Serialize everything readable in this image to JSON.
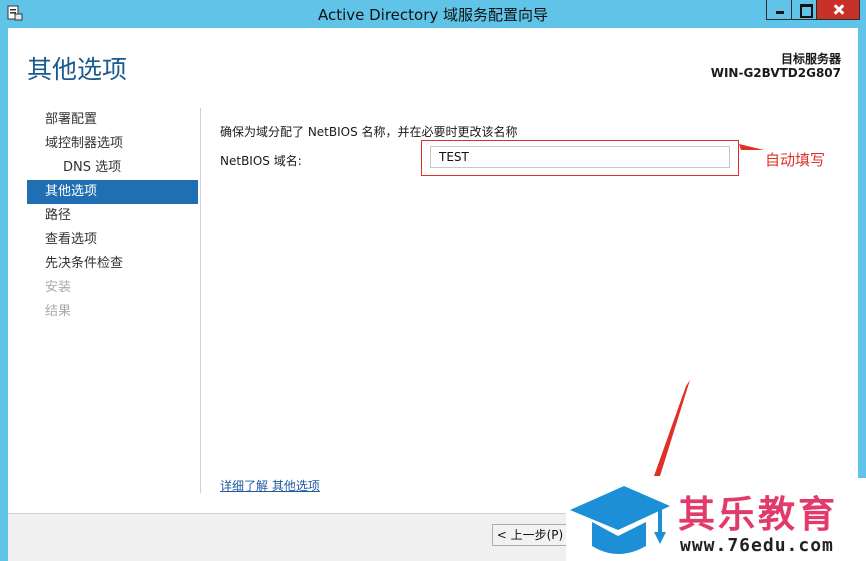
{
  "window": {
    "title": "Active Directory 域服务配置向导"
  },
  "header": {
    "page_title": "其他选项",
    "target_label": "目标服务器",
    "target_name": "WIN-G2BVTD2G807"
  },
  "nav": {
    "items": [
      {
        "label": "部署配置",
        "state": "normal"
      },
      {
        "label": "域控制器选项",
        "state": "normal"
      },
      {
        "label": "DNS 选项",
        "state": "sub"
      },
      {
        "label": "其他选项",
        "state": "active"
      },
      {
        "label": "路径",
        "state": "normal"
      },
      {
        "label": "查看选项",
        "state": "normal"
      },
      {
        "label": "先决条件检查",
        "state": "normal"
      },
      {
        "label": "安装",
        "state": "disabled"
      },
      {
        "label": "结果",
        "state": "disabled"
      }
    ]
  },
  "content": {
    "instruction": "确保为域分配了 NetBIOS 名称，并在必要时更改该名称",
    "netbios_label": "NetBIOS 域名:",
    "netbios_value": "TEST",
    "annotation": "自动填写",
    "learn_more": "详细了解 其他选项"
  },
  "footer": {
    "prev_label": "< 上一步(P)"
  },
  "watermark": {
    "brand": "其乐教育",
    "url": "www.76edu.com"
  },
  "colors": {
    "titlebar": "#5fc4e8",
    "accent": "#1f6fb2",
    "close": "#c7312a",
    "annotation": "#e0302a",
    "brand": "#e23a6a"
  }
}
